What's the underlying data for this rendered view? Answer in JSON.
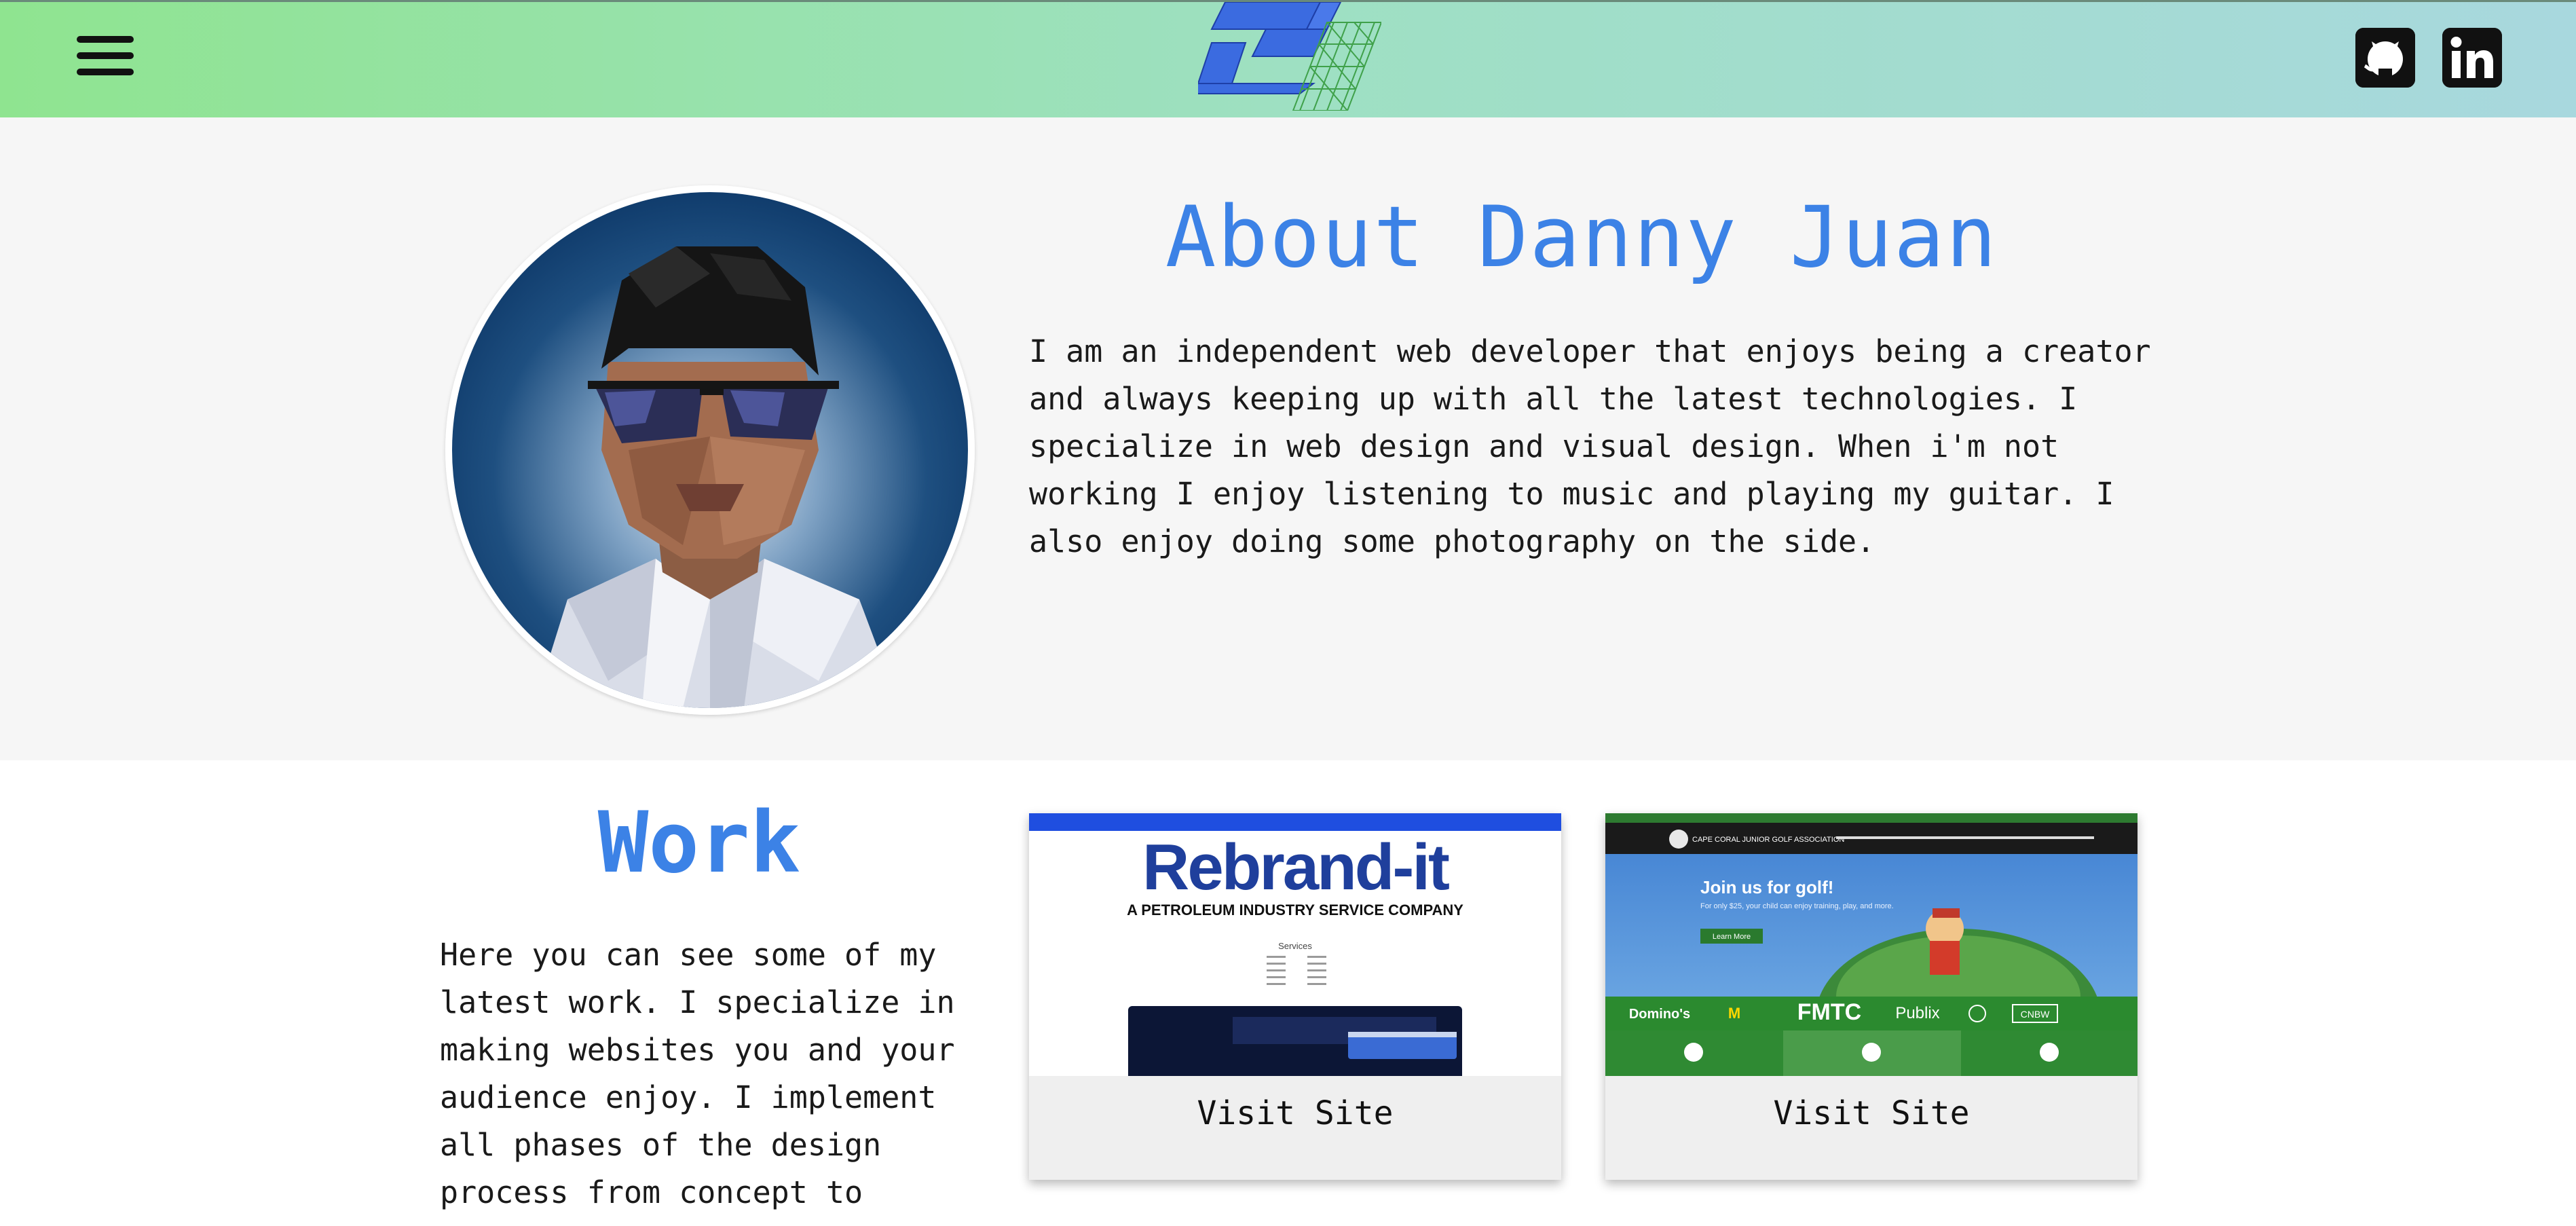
{
  "header": {
    "menu_icon": "hamburger-menu-icon",
    "logo_icon": "triangle-grid-logo",
    "social": [
      {
        "name": "GitHub",
        "icon": "github-icon"
      },
      {
        "name": "LinkedIn",
        "icon": "linkedin-icon"
      }
    ],
    "gradient": [
      "#8fe490",
      "#a8d8de"
    ]
  },
  "about": {
    "title": "About Danny Juan",
    "text": "I am an independent web developer that enjoys being a creator and always keeping up with all the latest technologies. I specialize in web design and visual design. When i'm not working I enjoy listening to music and playing my guitar. I also enjoy doing some photography on the side.",
    "avatar_icon": "low-poly-portrait"
  },
  "work": {
    "title": "Work",
    "text": "Here you can see some of my latest work. I specialize in making websites you and your audience enjoy. I implement all phases of the design process from concept to final",
    "projects": [
      {
        "visit_label": "Visit Site",
        "brand_logo": "Rebrand-it",
        "tagline": "A PETROLEUM INDUSTRY SERVICE COMPANY",
        "section_heading": "Services"
      },
      {
        "visit_label": "Visit Site",
        "brand_logo": "CAPE CORAL JUNIOR GOLF ASSOCIATION",
        "hero_title": "Join us for golf!",
        "hero_text": "For only $25, your child can enjoy training, play, and more.",
        "cta_label": "Learn More",
        "sponsors": [
          "Domino's",
          "FMTC",
          "Publix",
          "CNBW"
        ]
      }
    ]
  },
  "colors": {
    "accent": "#3c82e6",
    "about_bg": "#f6f6f6",
    "work_bg": "#ffffff",
    "golf_green": "#2a7a2e"
  }
}
